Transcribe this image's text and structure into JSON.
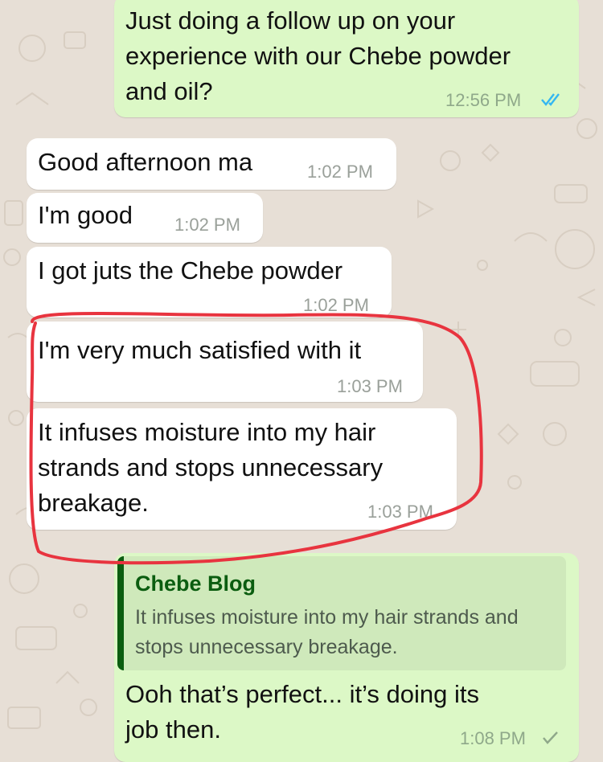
{
  "colors": {
    "outgoing_bubble": "#dcf8c6",
    "incoming_bubble": "#ffffff",
    "wallpaper": "#e7dfd6",
    "read_ticks": "#34b7f1",
    "quote_accent": "#0b5d10",
    "annotation_circle": "#e8343f"
  },
  "messages": [
    {
      "direction": "outgoing",
      "text": "Just doing a follow up on your\nexperience with our Chebe powder\nand oil?",
      "time": "12:56 PM",
      "status": "read-double-tick-icon"
    },
    {
      "direction": "incoming",
      "text": "Good afternoon ma",
      "time": "1:02 PM"
    },
    {
      "direction": "incoming",
      "text": "I'm good",
      "time": "1:02 PM"
    },
    {
      "direction": "incoming",
      "text": "I got juts the Chebe powder",
      "time": "1:02 PM"
    },
    {
      "direction": "incoming",
      "text": "I'm very much satisfied with it",
      "time": "1:03 PM"
    },
    {
      "direction": "incoming",
      "text": "It infuses moisture into my hair\nstrands and stops unnecessary\nbreakage.",
      "time": "1:03 PM"
    },
    {
      "direction": "outgoing",
      "quote": {
        "author": "Chebe Blog",
        "text": "It infuses moisture into my hair strands and stops unnecessary breakage."
      },
      "text": "Ooh that’s perfect... it’s doing its\njob then.",
      "time": "1:08 PM",
      "status": "sent-single-tick-icon"
    }
  ]
}
